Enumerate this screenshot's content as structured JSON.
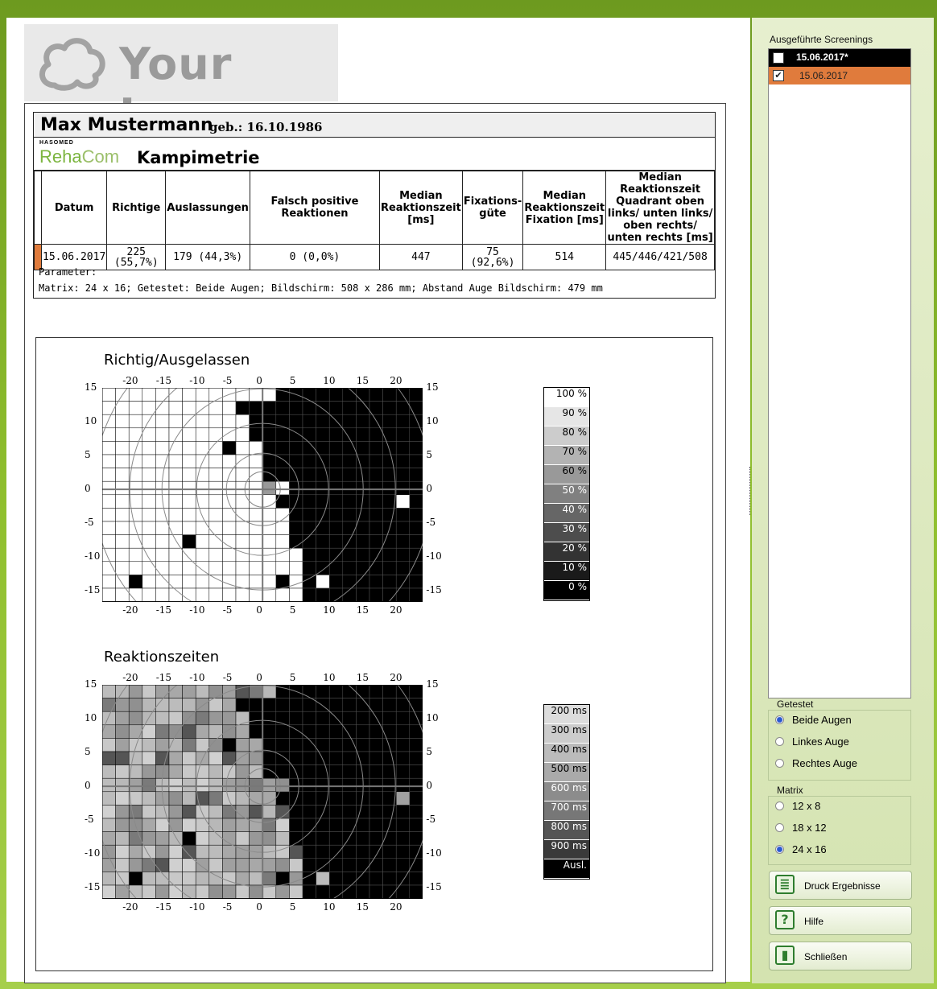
{
  "logo": {
    "text": "Your Logo"
  },
  "patient": {
    "name": "Max Mustermann",
    "dob": "geb.: 16.10.1986"
  },
  "brand": {
    "small": "HASOMED",
    "reha": "Reha",
    "com": "Com",
    "title": "Kampimetrie"
  },
  "table": {
    "headers": {
      "datum": "Datum",
      "richtige": "Richtige",
      "auslassungen": "Auslassungen",
      "falsch": "Falsch positive Reaktionen",
      "median": "Median Reaktionszeit [ms]",
      "fix": "Fixations-güte",
      "median_fix": "Median Reaktionszeit Fixation [ms]",
      "quadrant": "Median Reaktionszeit Quadrant oben links/ unten links/ oben rechts/ unten rechts [ms]"
    },
    "row": {
      "datum": "15.06.2017",
      "richtige": "225 (55,7%)",
      "auslassungen": "179 (44,3%)",
      "falsch": "0 (0,0%)",
      "median": "447",
      "fix": "75 (92,6%)",
      "median_fix": "514",
      "quadrant": "445/446/421/508"
    }
  },
  "params": {
    "label": "Parameter:",
    "text": "Matrix: 24 x 16; Getestet: Beide Augen; Bildschirm: 508 x 286 mm; Abstand Auge Bildschirm: 479 mm"
  },
  "plot1": {
    "title": "Richtig/Ausgelassen",
    "legend": [
      "100 %",
      "90 %",
      "80 %",
      "70 %",
      "60 %",
      "50 %",
      "40 %",
      "30 %",
      "20 %",
      "10 %",
      "0 %"
    ]
  },
  "plot2": {
    "title": "Reaktionszeiten",
    "legend": [
      "200 ms",
      "300 ms",
      "400 ms",
      "500 ms",
      "600 ms",
      "700 ms",
      "800 ms",
      "900 ms",
      "Ausl."
    ]
  },
  "side": {
    "screenings_title": "Ausgeführte Screenings",
    "screenings": [
      {
        "label": "15.06.2017*",
        "checked": false
      },
      {
        "label": "15.06.2017",
        "checked": true
      }
    ],
    "getestet_title": "Getestet",
    "getestet": [
      {
        "label": "Beide Augen",
        "selected": true
      },
      {
        "label": "Linkes Auge",
        "selected": false
      },
      {
        "label": "Rechtes Auge",
        "selected": false
      }
    ],
    "matrix_title": "Matrix",
    "matrix": [
      {
        "label": "12 x 8",
        "selected": false
      },
      {
        "label": "18 x 12",
        "selected": false
      },
      {
        "label": "24 x 16",
        "selected": true
      }
    ],
    "buttons": {
      "print": "Druck Ergebnisse",
      "help": "Hilfe",
      "close": "Schließen"
    }
  },
  "colors": {
    "accent": "#7cb540",
    "row_selected": "#e07b3c",
    "row_highlight": "#000000"
  }
}
